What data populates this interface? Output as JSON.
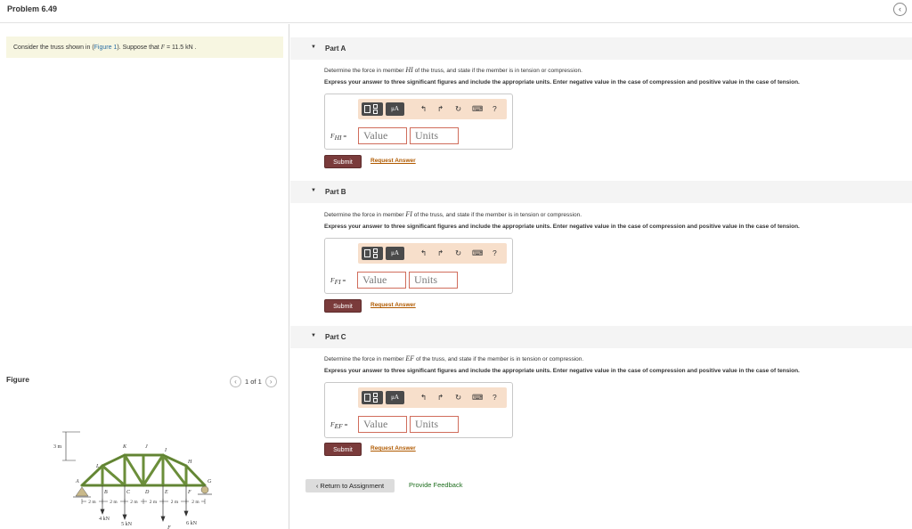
{
  "header": {
    "problem_title": "Problem 6.49",
    "collapse_glyph": "‹"
  },
  "intro": {
    "prefix": "Consider the truss shown in (",
    "figure_link": "Figure 1",
    "middle": "). Suppose that ",
    "var": "F",
    "value": " = 11.5  kN ."
  },
  "figure": {
    "label": "Figure",
    "pager": "1 of 1",
    "prev_glyph": "‹",
    "next_glyph": "›",
    "truss": {
      "height_label": "3 m",
      "nodes": [
        "A",
        "B",
        "C",
        "D",
        "E",
        "F",
        "G",
        "H",
        "I",
        "J",
        "K",
        "L"
      ],
      "spacing_labels": [
        "2 m",
        "2 m",
        "2 m",
        "2 m",
        "2 m",
        "2 m"
      ],
      "loads": [
        "4 kN",
        "5 kN",
        "F",
        "6 kN"
      ]
    }
  },
  "parts": [
    {
      "title": "Part A",
      "question_prefix": "Determine the force in member ",
      "member": "HI",
      "question_suffix": " of the truss, and state if the member is in tension or compression.",
      "instruction": "Express your answer to three significant figures and include the appropriate units. Enter negative value in the case of compression and positive value in the case of tension.",
      "answer_label": "F",
      "answer_sub": "HI",
      "answer_eq": " =",
      "value_placeholder": "Value",
      "units_placeholder": "Units",
      "submit": "Submit",
      "request": "Request Answer"
    },
    {
      "title": "Part B",
      "question_prefix": "Determine the force in member ",
      "member": "FI",
      "question_suffix": " of the truss, and state if the member is in tension or compression.",
      "instruction": "Express your answer to three significant figures and include the appropriate units. Enter negative value in the case of compression and positive value in the case of tension.",
      "answer_label": "F",
      "answer_sub": "FI",
      "answer_eq": " =",
      "value_placeholder": "Value",
      "units_placeholder": "Units",
      "submit": "Submit",
      "request": "Request Answer"
    },
    {
      "title": "Part C",
      "question_prefix": "Determine the force in member ",
      "member": "EF",
      "question_suffix": " of the truss, and state if the member is in tension or compression.",
      "instruction": "Express your answer to three significant figures and include the appropriate units. Enter negative value in the case of compression and positive value in the case of tension.",
      "answer_label": "F",
      "answer_sub": "EF",
      "answer_eq": " =",
      "value_placeholder": "Value",
      "units_placeholder": "Units",
      "submit": "Submit",
      "request": "Request Answer"
    }
  ],
  "toolbar": {
    "mu_label": "μA",
    "undo": "↰",
    "redo": "↱",
    "reset": "↻",
    "keyboard": "⌨",
    "help": "?"
  },
  "footer": {
    "return": "‹ Return to Assignment",
    "feedback": "Provide Feedback"
  },
  "colors": {
    "truss_member": "#6b8e3a",
    "submit_bg": "#7a3b3b",
    "toolbar_bg": "#f7dfcb",
    "link": "#b05a00",
    "intro_bg": "#f7f6e1"
  }
}
